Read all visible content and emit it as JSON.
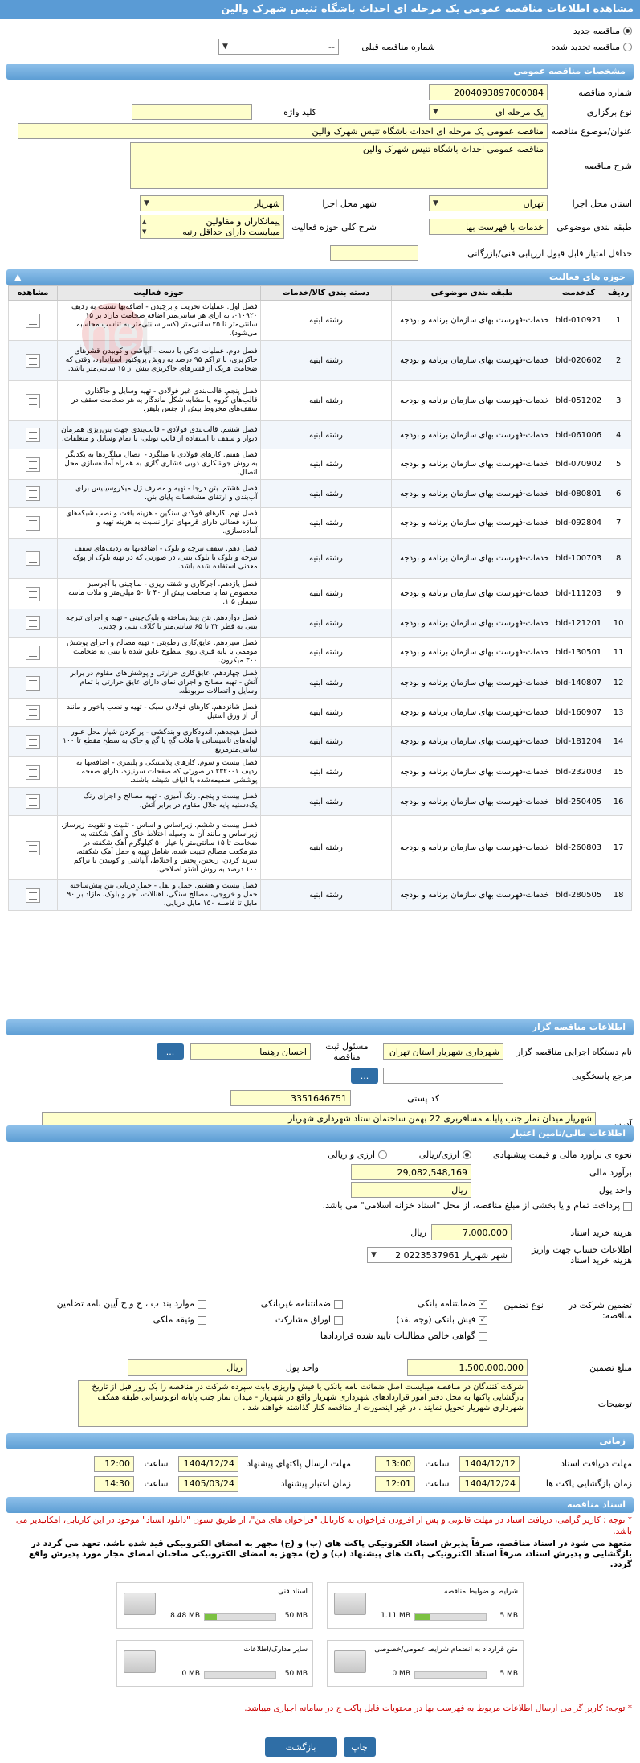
{
  "header": {
    "title": "مشاهده اطلاعات مناقصه عمومی یک مرحله ای احداث باشگاه تنیس شهرک والین"
  },
  "tender_type": {
    "new_label": "مناقصه جدید",
    "renewed_label": "مناقصه تجدید شده",
    "prev_number_label": "شماره مناقصه قبلی",
    "prev_number_value": "--"
  },
  "general": {
    "section_title": "مشخصات مناقصه عمومی",
    "number_label": "شماره مناقصه",
    "number_value": "2004093897000084",
    "method_label": "نوع برگزاری",
    "method_value": "یک مرحله ای",
    "keyword_label": "کلید واژه",
    "keyword_value": "",
    "subject_label": "عنوان/موضوع مناقصه",
    "subject_value": "مناقصه عمومی یک مرحله ای  احداث باشگاه تنیس شهرک والین",
    "desc_label": "شرح مناقصه",
    "desc_value": "مناقصه عمومی  احداث باشگاه تنیس شهرک والین",
    "province_label": "استان محل اجرا",
    "province_value": "تهران",
    "city_label": "شهر محل اجرا",
    "city_value": "شهریار",
    "category_label": "طبقه بندی موضوعی",
    "category_value": "خدمات با فهرست بها",
    "scope_label": "شرح کلی حوزه فعالیت",
    "scope_value_1": "پیمانکاران و مقاولین",
    "scope_value_2": "میبایست دارای حداقل رتبه",
    "min_score_label": "حداقل امتیاز قابل قبول ارزیابی فنی/بازرگانی",
    "min_score_value": ""
  },
  "activities": {
    "section_title": "حوزه های فعالیت",
    "columns": [
      "ردیف",
      "کدخدمت",
      "طبقه بندی موضوعی",
      "دسته بندی کالا/خدمات",
      "حوزه فعالیت",
      "مشاهده"
    ],
    "rows": [
      {
        "n": "1",
        "code": "bld-010921",
        "cat": "خدمات-فهرست بهای سازمان برنامه و بودجه",
        "group": "رشته ابنیه",
        "desc": "فصل اول. عملیات تخریب و برچیدن - اضافه‌بها نسبت به ردیف ۰۱۰۹۲۰، به ازای هر سانتی‌متر اضافه ضخامت مازاد بر ۱۵ سانتی‌متر تا ۲۵ سانتی‌متر (کسر سانتی‌متر به تناسب محاسبه می‌شود)."
      },
      {
        "n": "2",
        "code": "bld-020602",
        "cat": "خدمات-فهرست بهای سازمان برنامه و بودجه",
        "group": "رشته ابنیه",
        "desc": "فصل دوم. عملیات خاکی با دست - آبپاشی و کوبیدن قشرهای خاکریزی، با تراکم ۹۵ درصد به روش پروکتور استاندارد، وقتی که ضخامت هریک از قشرهای خاکریزی بیش از ۱۵ سانتی‌متر باشد."
      },
      {
        "n": "3",
        "code": "bld-051202",
        "cat": "خدمات-فهرست بهای سازمان برنامه و بودجه",
        "group": "رشته ابنیه",
        "desc": "فصل پنجم. قالب‌بندی غیر فولادی - تهیه وسایل و جاگذاری قالب‌های کروم یا مشابه شکل ماندگار به هر ضخامت سقف در سقف‌های مخروط بیش از جنس بلیقر."
      },
      {
        "n": "4",
        "code": "bld-061006",
        "cat": "خدمات-فهرست بهای سازمان برنامه و بودجه",
        "group": "رشته ابنیه",
        "desc": "فصل ششم. قالب‌بندی فولادی - قالب‌بندی جهت بتن‌ریزی همزمان دیوار و سقف با استفاده از قالب تونلی، با تمام وسایل و متعلقات."
      },
      {
        "n": "5",
        "code": "bld-070902",
        "cat": "خدمات-فهرست بهای سازمان برنامه و بودجه",
        "group": "رشته ابنیه",
        "desc": "فصل هفتم. کارهای فولادی با میلگرد - اتصال میلگردها به یکدیگر به روش جوشکاری ذوبی فشاری گازی به همراه آماده‌سازی محل اتصال."
      },
      {
        "n": "6",
        "code": "bld-080801",
        "cat": "خدمات-فهرست بهای سازمان برنامه و بودجه",
        "group": "رشته ابنیه",
        "desc": "فصل هشتم. بتن درجا - تهیه و مصرف ژل میکروسیلیس برای آب‌بندی و ارتقای مشخصات پایای بتن."
      },
      {
        "n": "7",
        "code": "bld-092804",
        "cat": "خدمات-فهرست بهای سازمان برنامه و بودجه",
        "group": "رشته ابنیه",
        "desc": "فصل نهم. کارهای فولادی سنگین - هزینه بافت و نصب شبکه‌های سازه فضائی دارای قرمهای تراز نسبت به هزینه تهیه و آماده‌سازی."
      },
      {
        "n": "8",
        "code": "bld-100703",
        "cat": "خدمات-فهرست بهای سازمان برنامه و بودجه",
        "group": "رشته ابنیه",
        "desc": "فصل دهم. سقف تیرچه و بلوک - اضافه‌بها به ردیف‌های سقف تیرچه و بلوک با بلوک بتنی، در صورتی که در تهیه بلوک از پوکه معدنی استفاده شده باشد."
      },
      {
        "n": "9",
        "code": "bld-111203",
        "cat": "خدمات-فهرست بهای سازمان برنامه و بودجه",
        "group": "رشته ابنیه",
        "desc": "فصل یازدهم. آجرکاری و شفته ریزی - نماچینی با آجرسبز مخصوص نما با ضخامت بیش از ۴۰ تا ۵۰ میلی‌متر و ملات ماسه سیمان ۱:۵."
      },
      {
        "n": "10",
        "code": "bld-121201",
        "cat": "خدمات-فهرست بهای سازمان برنامه و بودجه",
        "group": "رشته ابنیه",
        "desc": "فصل دوازدهم. بتن پیش‌ساخته و بلوک‌چینی - تهیه و اجرای تیرچه بتنی به قطر ۳۲ تا ۶۵ سانتی‌متر با کلاف بتنی و چدنی."
      },
      {
        "n": "11",
        "code": "bld-130501",
        "cat": "خدمات-فهرست بهای سازمان برنامه و بودجه",
        "group": "رشته ابنیه",
        "desc": "فصل سیزدهم. عایق‌کاری رطوبتی - تهیه مصالح و اجرای پوشش موممی یا پایه قیری روی سطوح عایق شده با بتنی به ضخامت ۳۰۰ میکرون."
      },
      {
        "n": "12",
        "code": "bld-140807",
        "cat": "خدمات-فهرست بهای سازمان برنامه و بودجه",
        "group": "رشته ابنیه",
        "desc": "فصل چهاردهم. عایق‌کاری حرارتی و پوشش‌های مقاوم در برابر آتش - تهیه مصالح و اجرای نمای دارای عایق حرارتی با تمام وسایل و اتصالات مربوطه."
      },
      {
        "n": "13",
        "code": "bld-160907",
        "cat": "خدمات-فهرست بهای سازمان برنامه و بودجه",
        "group": "رشته ابنیه",
        "desc": "فصل شانزدهم. کارهای فولادی سبک - تهیه و نصب پاخور و مانند آن از ورق استیل."
      },
      {
        "n": "14",
        "code": "bld-181204",
        "cat": "خدمات-فهرست بهای سازمان برنامه و بودجه",
        "group": "رشته ابنیه",
        "desc": "فصل هیجدهم. اندودکاری و بندکشی - پر کردن شیار محل عبور لوله‌های تاسیساتی با ملات گچ یا گچ و خاک به سطح مقطع تا ۱۰۰ سانتی‌مترمربع."
      },
      {
        "n": "15",
        "code": "bld-232003",
        "cat": "خدمات-فهرست بهای سازمان برنامه و بودجه",
        "group": "رشته ابنیه",
        "desc": "فصل بیست و سوم. کارهای پلاستیکی و پلیمری - اضافه‌بها به ردیف ۲۳۲۰۰۱ در صورتی که صفحات سرنیزه، دارای صفحه پوششی ضمیمه‌شده با الیاف شیشه باشند."
      },
      {
        "n": "16",
        "code": "bld-250405",
        "cat": "خدمات-فهرست بهای سازمان برنامه و بودجه",
        "group": "رشته ابنیه",
        "desc": "فصل بیست و پنجم. رنگ آمیزی - تهیه مصالح و اجرای رنگ یک‌دستیه پایه جلال مقاوم در برابر آتش."
      },
      {
        "n": "17",
        "code": "bld-260803",
        "cat": "خدمات-فهرست بهای سازمان برنامه و بودجه",
        "group": "رشته ابنیه",
        "desc": "فصل بیست و ششم. زیراساس و اساس - تثبیت و تقویت زیرساز، زیراساس و مانند آن به وسیله اختلاط خاک و آهک شکفته به ضخامت تا ۱۵ سانتی‌متر با عیار ۵۰ کیلوگرم آهک شکفته در مترمکعب مصالح تثبیت شده. شامل تهیه و حمل آهک شکفته، سرند کردن، ریختن، پخش و اختلاط، آبپاشی و کوبیدن با تراکم ۱۰۰ درصد به روش آشتو اصلاحی."
      },
      {
        "n": "18",
        "code": "bld-280505",
        "cat": "خدمات-فهرست بهای سازمان برنامه و بودجه",
        "group": "رشته ابنیه",
        "desc": "فصل بیست و هشتم. حمل و نقل - حمل دریایی بتن پیش‌ساخته حمل و خروجی، مصالح سنگی، اهنالات، آجر و بلوک، مازاد بر ۹۰ مایل تا فاصله ۱۵۰ مایل دریایی."
      }
    ]
  },
  "organizer": {
    "section_title": "اطلاعات مناقصه گزار",
    "org_label": "نام دستگاه اجرایی مناقصه گزار",
    "org_value": "شهرداری شهریار استان تهران",
    "officer_label": "مسئول ثبت مناقصه",
    "officer_value": "احسان رهنما",
    "ref_label": "مرجع پاسخگویی",
    "ref_value": "",
    "postal_label": "کد پستی",
    "postal_value": "3351646751",
    "address_label": "آدرس",
    "address_value": "شهریار میدان نماز  جنب پایانه مسافربری  22 بهمن ساختمان ستاد شهرداری شهریار",
    "btn_dots": "..."
  },
  "finance": {
    "section_title": "اطلاعات مالی/تامین اعتبار",
    "estimate_type_label": "نحوه ی برآورد مالی و قیمت پیشنهادی",
    "rial_label": "ارزی/ریالی",
    "currency_label": "ارزی و ریالی",
    "estimate_label": "برآورد مالی",
    "estimate_value": "29,082,548,169",
    "unit_label": "واحد پول",
    "unit_value": "ریال",
    "treasury_text": "پرداخت تمام و یا بخشی از مبلغ مناقصه، از محل \"اسناد خزانه اسلامی\" می باشد.",
    "doc_cost_label": "هزینه خرید اسناد",
    "doc_cost_value": "7,000,000",
    "doc_cost_unit": "ریال",
    "account_label": "اطلاعات حساب جهت واریز هزینه خرید اسناد",
    "account_value": "شهر شهریار 0223537961 2"
  },
  "guarantee": {
    "participation_label": "تضمین شرکت در مناقصه:",
    "type_label": "نوع تضمین",
    "options": [
      "ضمانتنامه بانکی",
      "ضمانتنامه غیربانکی",
      "موارد بند ب ، ج و ح آیین نامه تضامین",
      "فیش بانکی (وجه نقد)",
      "اوراق مشارکت",
      "وثیقه ملکی",
      "گواهی خالص مطالبات تایید شده قراردادها"
    ],
    "amount_label": "مبلغ تضمین",
    "amount_value": "1,500,000,000",
    "unit_label": "واحد پول",
    "unit_value": "ریال",
    "notes_label": "توضیحات",
    "notes_value": "شرکت کنندگان در مناقصه میبایست اصل ضمانت نامه بانکی یا فیش واریزی بابت سپرده شرکت در مناقصه را یک روز قبل از تاریخ بازگشایی پاکتها به محل دفتر امور قراردادهای شهرداری شهریار واقع در شهریار - میدان نماز جنب پایانه اتوبوسرانی طبقه همکف شهرداری شهریار تحویل نمایند . در غیر اینصورت از مناقصه کنار گذاشته خواهند شد ."
  },
  "timing": {
    "section_title": "زمانی",
    "receive_deadline_label": "مهلت دریافت اسناد",
    "receive_deadline_date": "1404/12/12",
    "receive_deadline_time": "13:00",
    "send_deadline_label": "مهلت ارسال پاکتهای پیشنهاد",
    "send_deadline_date": "1404/12/24",
    "send_deadline_time": "12:00",
    "opening_label": "زمان بازگشایی پاکت ها",
    "opening_date": "1404/12/24",
    "opening_time": "12:01",
    "validity_label": "زمان اعتبار پیشنهاد",
    "validity_date": "1405/03/24",
    "validity_time": "14:30",
    "time_label": "ساعت"
  },
  "documents": {
    "section_title": "اسناد مناقصه",
    "note_1": "* توجه : کاربر گرامی، دریافت اسناد در مهلت قانونی و پس از افزودن فراخوان به کارتابل \"فراخوان های من\"، از طریق ستون \"دانلود اسناد\" موجود در این کارتابل، امکانپذیر می باشد.",
    "note_2": "متعهد می شود در اسناد مناقصه، صرفاً پذیرش اسناد الکترونیکی پاکت های (ب) و (ج) مجهز به امضای الکترونیکی قید شده باشد. تعهد می گردد در بازگشایی و پذیرش اسناد، صرفاً اسناد الکترونیکی پاکت های پیشنهاد (ب) و (ج) مجهز به امضای الکترونیکی صاحبان امضای مجاز مورد پذیرش واقع گردد.",
    "note_3": "* توجه: کاربر گرامی ارسال اطلاعات مربوط به فهرست بها در محتویات فایل پاکت ج در سامانه اجباری میباشد.",
    "files": [
      {
        "label": "شرایط و ضوابط مناقصه",
        "size": "1.11 MB",
        "max": "5 MB",
        "fill": 0.22
      },
      {
        "label": "اسناد فنی",
        "size": "8.48 MB",
        "max": "50 MB",
        "fill": 0.17
      },
      {
        "label": "متن قرارداد به انضمام شرایط عمومی/خصوصی",
        "size": "0 MB",
        "max": "5 MB",
        "fill": 0
      },
      {
        "label": "سایر مدارک/اطلاعات",
        "size": "0 MB",
        "max": "50 MB",
        "fill": 0
      }
    ]
  },
  "footer": {
    "print_label": "چاپ",
    "back_label": "بازگشت"
  },
  "watermark": {
    "text": "Tender.net"
  },
  "colors": {
    "section": "#5d9ed4",
    "input_bg": "#ffffcc",
    "button": "#2f6ea6",
    "note": "#cc0000"
  }
}
